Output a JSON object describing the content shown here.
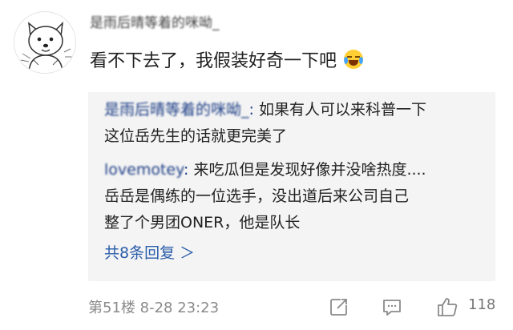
{
  "comment": {
    "username": "是雨后晴等着的咪呦_",
    "text": "看不下去了，我假装好奇一下吧",
    "emoji": "laughing-crying-icon"
  },
  "replies": [
    {
      "name": "是雨后晴等着的咪呦_",
      "colon": ":",
      "lines": [
        "如果有人可以来科普一下",
        "这位岳先生的话就更完美了"
      ]
    },
    {
      "name": "lovemotey",
      "colon": ":",
      "lines": [
        "来吃瓜但是发现好像并没啥热度....",
        "岳岳是偶练的一位选手，没出道后来公司自己",
        "整了个男团ONER，他是队长"
      ]
    }
  ],
  "more_replies": "共8条回复 ＞",
  "footer": {
    "floor": "第51楼",
    "date": "8-28 23:23",
    "like_count": "118",
    "icons": [
      "share-icon",
      "comment-icon",
      "like-icon"
    ]
  },
  "colors": {
    "name_link": "#1e3f86",
    "more_link": "#2a5caa",
    "reply_bg": "#f4f4f4",
    "muted": "#8a8a8a"
  }
}
